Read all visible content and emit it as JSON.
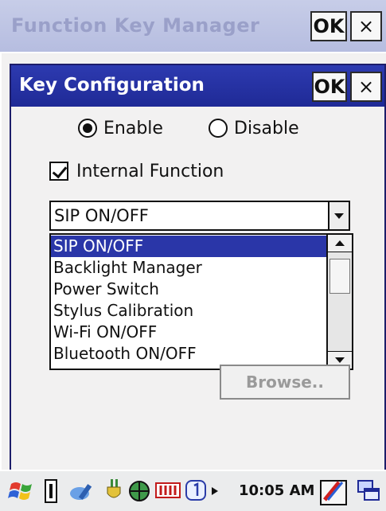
{
  "background_window": {
    "title": "Function Key Manager",
    "ok_label": "OK",
    "close_label": "×"
  },
  "dialog": {
    "title": "Key Configuration",
    "ok_label": "OK",
    "close_label": "×",
    "enable_label": "Enable",
    "disable_label": "Disable",
    "enable_selected": true,
    "internal_function_label": "Internal Function",
    "internal_function_checked": true,
    "combo_value": "SIP ON/OFF",
    "dropdown_items": [
      "SIP ON/OFF",
      "Backlight Manager",
      "Power Switch",
      "Stylus Calibration",
      "Wi-Fi ON/OFF",
      "Bluetooth ON/OFF"
    ],
    "selected_index": 0,
    "browse_label": "Browse.."
  },
  "taskbar": {
    "start_icon": "windows-flag-icon",
    "clock": "10:05 AM",
    "tray_icons": [
      "input-panel-icon",
      "sync-icon",
      "power-plug-icon",
      "network-icon",
      "battery-icon",
      "notification-1-icon",
      "arrow-right-icon",
      "input-method-icon",
      "window-switch-icon"
    ]
  },
  "colors": {
    "title_active": "#2a36a8",
    "title_inactive": "#b6bde0"
  }
}
